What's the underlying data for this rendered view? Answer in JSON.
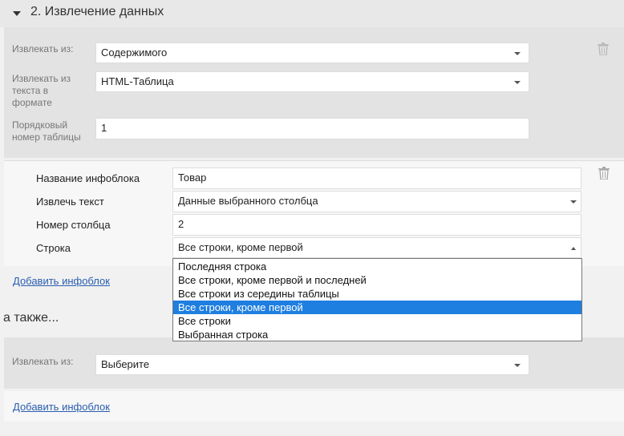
{
  "section": {
    "title": "2. Извлечение данных"
  },
  "group1": {
    "extract_from_label": "Извлекать из:",
    "extract_from_value": "Содержимого",
    "format_label": "Извлекать из текста в формате",
    "format_value": "HTML-Таблица",
    "table_no_label": "Порядковый номер таблицы",
    "table_no_value": "1"
  },
  "infoblock": {
    "name_label": "Название инфоблока",
    "name_value": "Товар",
    "extract_text_label": "Извлечь текст",
    "extract_text_value": "Данные выбранного столбца",
    "column_no_label": "Номер столбца",
    "column_no_value": "2",
    "row_label": "Строка",
    "row_value": "Все строки, кроме первой"
  },
  "row_options": [
    "Последняя строка",
    "Все строки, кроме первой и последней",
    "Все строки из середины таблицы",
    "Все строки, кроме первой",
    "Все строки",
    "Выбранная строка"
  ],
  "selected_option_index": 3,
  "add_infoblock_label": "Добавить инфоблок",
  "also_section": {
    "title": "а также...",
    "extract_from_label": "Извлекать из:",
    "extract_from_value": "Выберите",
    "add_infoblock_label": "Добавить инфоблок"
  },
  "icons": {
    "collapse": "caret-down-icon",
    "delete": "trash-icon",
    "dropdown": "chevron-down-icon"
  },
  "colors": {
    "accent": "#1e7fe0",
    "link": "#2a5db0"
  }
}
